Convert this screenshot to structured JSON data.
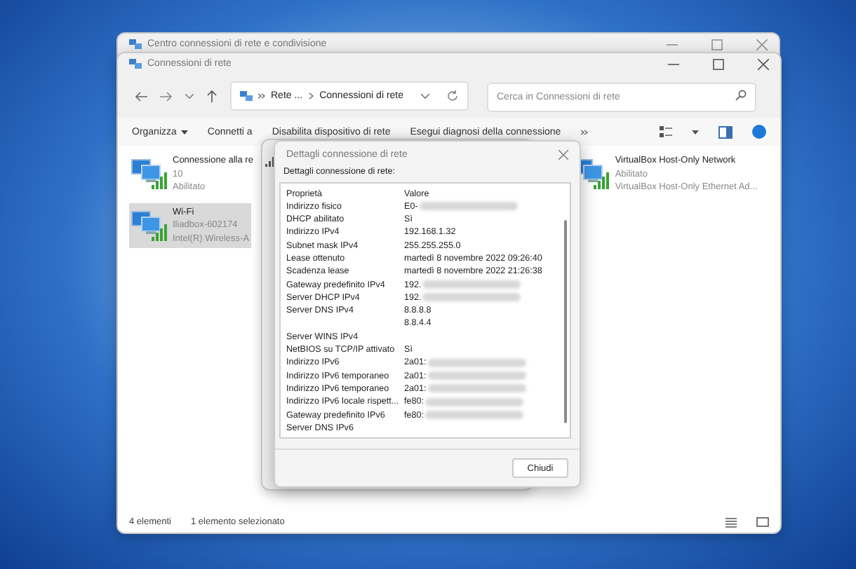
{
  "back_window": {
    "title": "Centro connessioni di rete e condivisione"
  },
  "window": {
    "title": "Connessioni di rete"
  },
  "address_bar": {
    "crumbs": [
      "Rete ...",
      "Connessioni di rete"
    ]
  },
  "search": {
    "placeholder": "Cerca in Connessioni di rete"
  },
  "toolbar": [
    {
      "label": "Organizza",
      "dropdown": true
    },
    {
      "label": "Connetti a",
      "dropdown": false
    },
    {
      "label": "Disabilita dispositivo di rete",
      "dropdown": false
    },
    {
      "label": "Esegui diagnosi della connessione",
      "dropdown": false
    }
  ],
  "connection_columns": [
    [
      {
        "name": "Connessione alla re",
        "lines": [
          "10",
          "Abilitato"
        ],
        "selected": false
      },
      {
        "name": "Wi-Fi",
        "lines": [
          "Iliadbox-602174",
          "Intel(R) Wireless-A"
        ],
        "selected": true
      }
    ],
    [
      {
        "name": "VirtualBox Host-Only Network",
        "lines": [
          "Abilitato",
          "VirtualBox Host-Only Ethernet Ad..."
        ],
        "selected": false
      }
    ]
  ],
  "status_bar": {
    "count": "4 elementi",
    "selection": "1 elemento selezionato"
  },
  "dialog": {
    "title": "Dettagli connessione di rete",
    "caption": "Dettagli connessione di rete:",
    "columns": [
      "Proprietà",
      "Valore"
    ],
    "rows": [
      {
        "label": "Indirizzo fisico",
        "value": "E0-",
        "blurred": true
      },
      {
        "label": "DHCP abilitato",
        "value": "Sì",
        "blurred": false
      },
      {
        "label": "Indirizzo IPv4",
        "value": "192.168.1.32",
        "blurred": false
      },
      {
        "label": "Subnet mask IPv4",
        "value": "255.255.255.0",
        "blurred": false
      },
      {
        "label": "Lease ottenuto",
        "value": "martedì 8 novembre 2022 09:26:40",
        "blurred": false
      },
      {
        "label": "Scadenza lease",
        "value": "martedì 8 novembre 2022 21:26:38",
        "blurred": false
      },
      {
        "label": "Gateway predefinito IPv4",
        "value": "192.",
        "blurred": true
      },
      {
        "label": "Server DHCP IPv4",
        "value": "192.",
        "blurred": true
      },
      {
        "label": "Server DNS IPv4",
        "value": "8.8.8.8",
        "blurred": false
      },
      {
        "value": "8.8.4.4",
        "blurred": false
      },
      {
        "label": "Server WINS IPv4",
        "blurred": false
      },
      {
        "label": "NetBIOS su TCP/IP attivato",
        "value": "Sì",
        "blurred": false
      },
      {
        "label": "Indirizzo IPv6",
        "value": "2a01:",
        "blurred": true
      },
      {
        "label": "Indirizzo IPv6 temporaneo",
        "value": "2a01:",
        "blurred": true
      },
      {
        "label": "Indirizzo IPv6 temporaneo",
        "value": "2a01:",
        "blurred": true
      },
      {
        "label": "Indirizzo IPv6 locale rispett...",
        "value": "fe80:",
        "blurred": true
      },
      {
        "label": "Gateway predefinito IPv6",
        "value": "fe80:",
        "blurred": true
      },
      {
        "label": "Server DNS IPv6",
        "blurred": false
      }
    ],
    "button": "Chiudi"
  }
}
